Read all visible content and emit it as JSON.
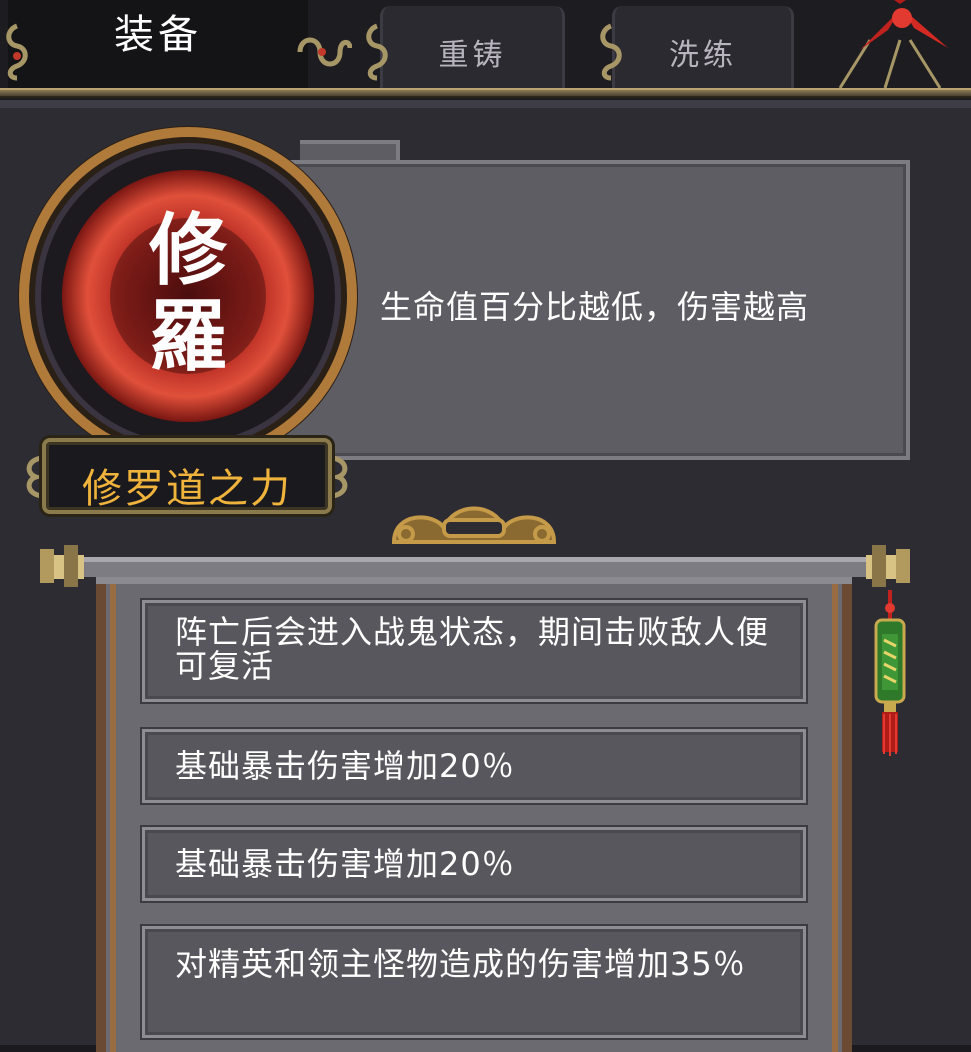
{
  "tabs": [
    {
      "label": "装备",
      "active": true
    },
    {
      "label": "重铸",
      "active": false
    },
    {
      "label": "洗练",
      "active": false
    }
  ],
  "item": {
    "emblem_text": "修羅",
    "name": "修罗道之力",
    "description": "生命值百分比越低，伤害越高"
  },
  "affixes": [
    "阵亡后会进入战鬼状态，期间击败敌人便可复活",
    "基础暴击伤害增加20％",
    "基础暴击伤害增加20％",
    "对精英和领主怪物造成的伤害增加35％"
  ],
  "colors": {
    "title_gold": "#f0b43c",
    "emblem_red": "#c8322a",
    "frame_bronze": "#8b7a4c"
  },
  "icons": [
    "knot-ornament-icon",
    "red-ribbon-icon",
    "tassel-icon",
    "cloud-ornament-icon"
  ]
}
